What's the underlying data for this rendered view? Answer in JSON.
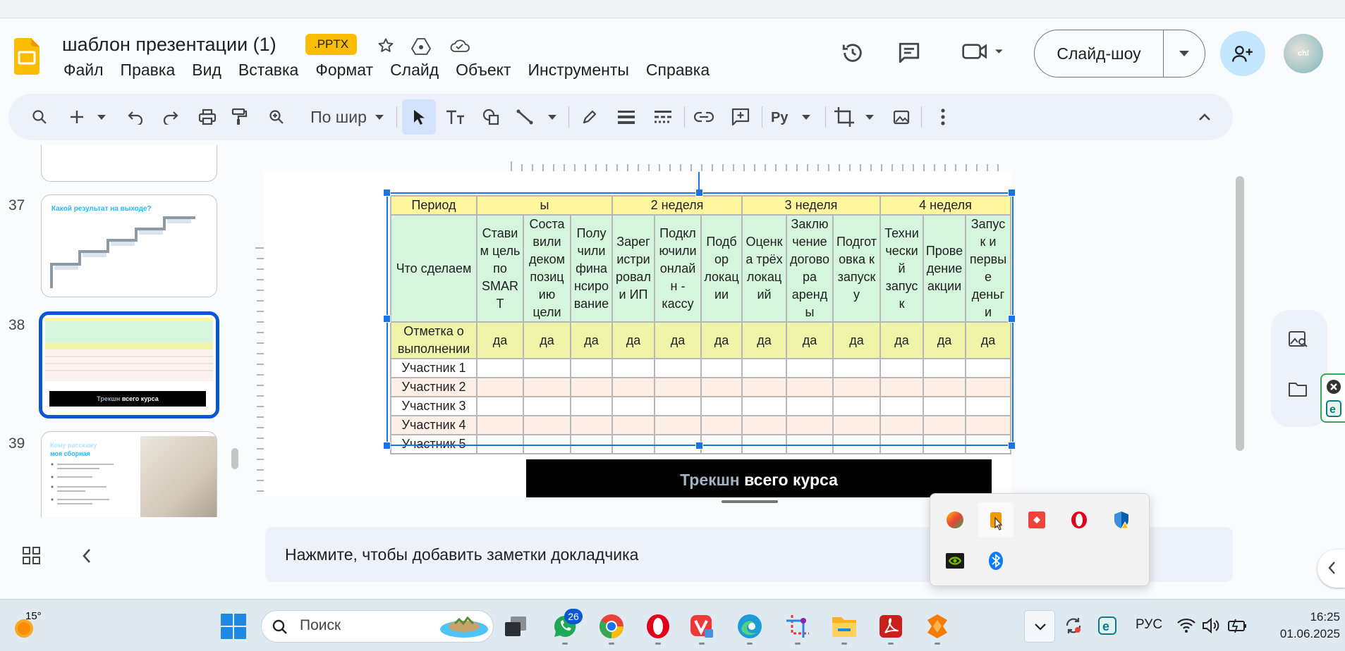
{
  "document": {
    "title": "шаблон презентации (1)",
    "badge": ".PPTX"
  },
  "menu": [
    "Файл",
    "Правка",
    "Вид",
    "Вставка",
    "Формат",
    "Слайд",
    "Объект",
    "Инструменты",
    "Справка"
  ],
  "header": {
    "slideshow_label": "Слайд-шоу"
  },
  "toolbar": {
    "zoom_label": "По шир"
  },
  "filmstrip": {
    "slides": [
      {
        "number": "37",
        "title": "Какой результат на выходе?"
      },
      {
        "number": "38",
        "banner_muted": "Трекшн",
        "banner_bold": "всего курса",
        "selected": true
      },
      {
        "number": "39",
        "title": "Кому расскажу",
        "subtitle": "моя сборная"
      }
    ]
  },
  "slide": {
    "table": {
      "header_row": [
        "Период",
        "ы",
        "2 неделя",
        "3 неделя",
        "4 неделя"
      ],
      "tasks_label": "Что сделаем",
      "tasks": [
        "Стави м цель по SMAR T",
        "Соста вили деком позиц ию цели",
        "Полу чили фина нсиро вание",
        "Зарег истри ровал и ИП",
        "Подкл ючили онлай н - кассу",
        "Подб ор локац ии",
        "Оценк а трёх локац ий",
        "Заклю чение догово ра аренд ы",
        "Подгот овка к запуск у",
        "Техни чески й запус к",
        "Прове дение акции",
        "Запус к и первы е деньг и"
      ],
      "mark_label": "Отметка о выполнении",
      "mark_value": "да",
      "participants": [
        "Участник 1",
        "Участник 2",
        "Участник 3",
        "Участник 4",
        "Участник 5"
      ]
    },
    "banner_muted": "Трекшн",
    "banner_bold": "всего курса"
  },
  "notes": {
    "placeholder": "Нажмите, чтобы добавить заметки докладчика"
  },
  "taskbar": {
    "weather_temp": "15°",
    "search_placeholder": "Поиск",
    "whatsapp_badge": "26",
    "language": "РУС",
    "time": "16:25",
    "date": "01.06.2025"
  }
}
